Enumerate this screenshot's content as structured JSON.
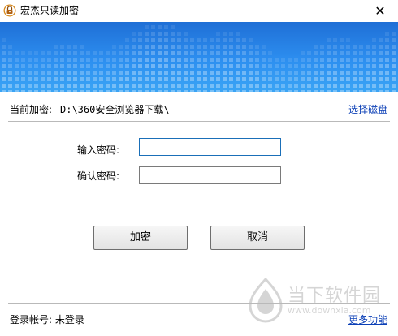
{
  "window": {
    "title": "宏杰只读加密",
    "close_glyph": "✕"
  },
  "current": {
    "label": "当前加密:",
    "path": "D:\\360安全浏览器下载\\",
    "select_disk": "选择磁盘"
  },
  "form": {
    "password_label": "输入密码:",
    "confirm_label": "确认密码:",
    "password_value": "",
    "confirm_value": ""
  },
  "buttons": {
    "encrypt": "加密",
    "cancel": "取消"
  },
  "footer": {
    "account_label": "登录帐号:",
    "account_value": "未登录",
    "more": "更多功能"
  },
  "watermark": {
    "name": "当下软件园",
    "url": "www.downxia.com"
  },
  "colors": {
    "banner": "#2d8ff0",
    "link": "#0b3fb6",
    "focus_border": "#1a6fb8"
  },
  "icons": {
    "app": "lock-icon",
    "close": "close-icon"
  }
}
